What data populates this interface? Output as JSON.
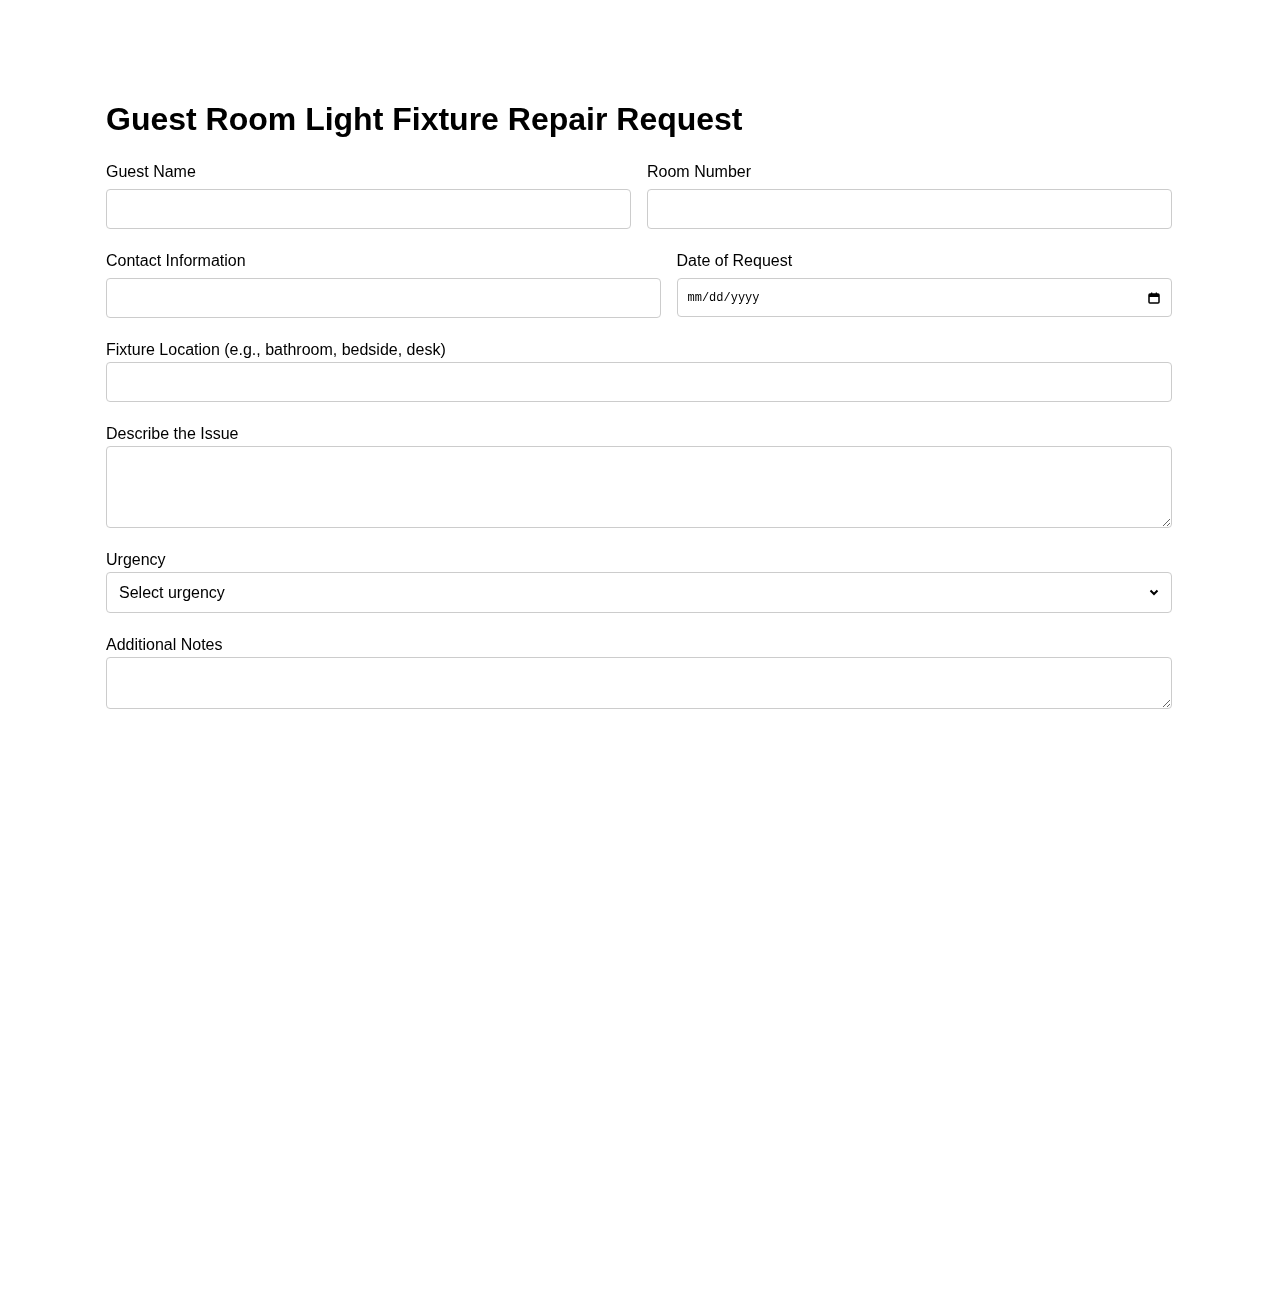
{
  "title": "Guest Room Light Fixture Repair Request",
  "rows": [
    [
      {
        "kind": "text",
        "label": "Guest Name"
      },
      {
        "kind": "text",
        "label": "Room Number"
      }
    ],
    [
      {
        "kind": "text",
        "label": "Contact Information"
      },
      {
        "kind": "date",
        "label": "Date of Request",
        "placeholder": "mm/dd/yyyy"
      }
    ],
    [
      {
        "kind": "text",
        "label": "Fixture Location (e.g., bathroom, bedside, desk)"
      }
    ],
    [
      {
        "kind": "textarea",
        "label": "Describe the Issue"
      }
    ],
    [
      {
        "kind": "select",
        "label": "Urgency",
        "value": "Select urgency"
      }
    ],
    [
      {
        "kind": "textarea",
        "label": "Additional Notes"
      }
    ]
  ]
}
